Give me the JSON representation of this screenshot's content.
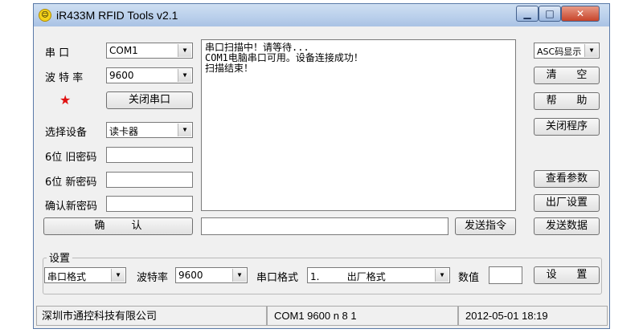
{
  "window": {
    "title": "iR433M RFID Tools v2.1",
    "min": "▁",
    "max": "□",
    "close": "✕"
  },
  "left": {
    "port_label": "串    口",
    "port_value": "COM1",
    "baud_label": "波 特 率",
    "baud_value": "9600",
    "close_port_button": "关闭串口",
    "device_label": "选择设备",
    "device_value": "读卡器",
    "old_pwd_label": "6位 旧密码",
    "new_pwd_label": "6位 新密码",
    "confirm_pwd_label": "确认新密码",
    "confirm_button": "确        认"
  },
  "log": {
    "lines": [
      "串口扫描中！请等待...",
      "COM1电脑串口可用。设备连接成功！",
      "扫描结束！"
    ]
  },
  "command": {
    "send_command_button": "发送指令"
  },
  "right": {
    "display_mode": "ASC码显示",
    "clear_button": "清      空",
    "help_button": "帮      助",
    "exit_button": "关闭程序",
    "params_button": "查看参数",
    "factory_button": "出厂设置",
    "send_data_button": "发送数据"
  },
  "settings": {
    "title": "设置",
    "port_format": "串口格式",
    "baud_label": "波特率",
    "baud_value": "9600",
    "format_label": "串口格式",
    "format_value": "1.         出厂格式",
    "number_label": "数值",
    "set_button": "设      置"
  },
  "status": {
    "company": "深圳市通控科技有限公司",
    "port_info": "COM1 9600 n 8 1",
    "datetime": "2012-05-01 18:19"
  }
}
